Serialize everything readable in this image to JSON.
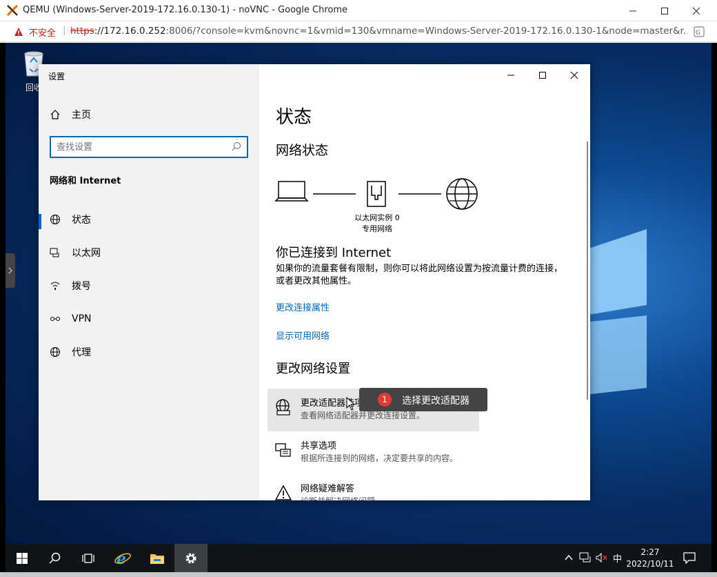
{
  "browser": {
    "title": "QEMU (Windows-Server-2019-172.16.0.130-1) - noVNC - Google Chrome",
    "insecure_label": "不安全",
    "url_scheme": "https",
    "url_host": "://172.16.0.252",
    "url_rest": ":8006/?console=kvm&novnc=1&vmid=130&vmname=Windows-Server-2019-172.16.0.130-1&node=master&r..."
  },
  "desktop": {
    "recycle_bin_label": "回收"
  },
  "settings": {
    "app_title": "设置",
    "home_label": "主页",
    "search_placeholder": "查找设置",
    "section_title": "网络和 Internet",
    "nav_items": [
      {
        "label": "状态",
        "icon": "globe-icon"
      },
      {
        "label": "以太网",
        "icon": "ethernet-icon"
      },
      {
        "label": "拨号",
        "icon": "dialup-icon"
      },
      {
        "label": "VPN",
        "icon": "vpn-icon"
      },
      {
        "label": "代理",
        "icon": "globe-icon"
      }
    ],
    "page_title": "状态",
    "network_status_heading": "网络状态",
    "adapter_name": "以太网实例 0",
    "network_type": "专用网络",
    "connected_heading": "你已连接到 Internet",
    "connected_desc": "如果你的流量套餐有限制，则你可以将此网络设置为按流量计费的连接，或者更改其他属性。",
    "link_change_props": "更改连接属性",
    "link_show_networks": "显示可用网络",
    "change_settings_heading": "更改网络设置",
    "options": [
      {
        "title": "更改适配器选项",
        "desc": "查看网络适配器并更改连接设置。"
      },
      {
        "title": "共享选项",
        "desc": "根据所连接到的网络，决定要共享的内容。"
      },
      {
        "title": "网络疑难解答",
        "desc": "诊断并解决网络问题。"
      }
    ]
  },
  "tooltip": {
    "badge": "1",
    "text": "选择更改适配器"
  },
  "taskbar": {
    "ime": "中",
    "time": "2:27",
    "date": "2022/10/11"
  }
}
